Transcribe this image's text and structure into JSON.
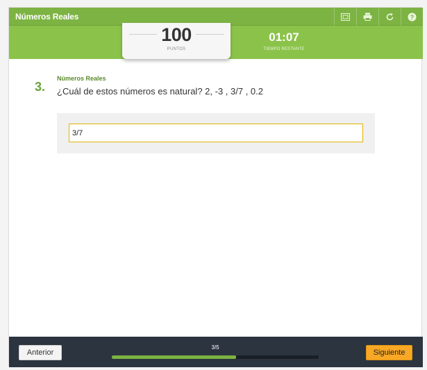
{
  "app": {
    "title": "Números Reales",
    "toolbar": [
      "screen-icon",
      "print-icon",
      "restart-icon",
      "help-icon"
    ]
  },
  "score": {
    "value": "100",
    "label": "PUNTOS"
  },
  "timer": {
    "value": "01:07",
    "label": "TIEMPO RESTANTE"
  },
  "question": {
    "number": "3.",
    "category": "Números Reales",
    "text": "¿Cuál de estos números es natural? 2, -3 , 3/7 , 0.2",
    "answer_value": "3/7"
  },
  "footer": {
    "prev_label": "Anterior",
    "next_label": "Siguiente",
    "progress_text": "3/5",
    "progress_fraction": 0.6
  },
  "colors": {
    "header_green": "#8bc34a",
    "accent_orange": "#f9a825",
    "footer_dark": "#2c3440",
    "progress_green": "#7cb342"
  }
}
